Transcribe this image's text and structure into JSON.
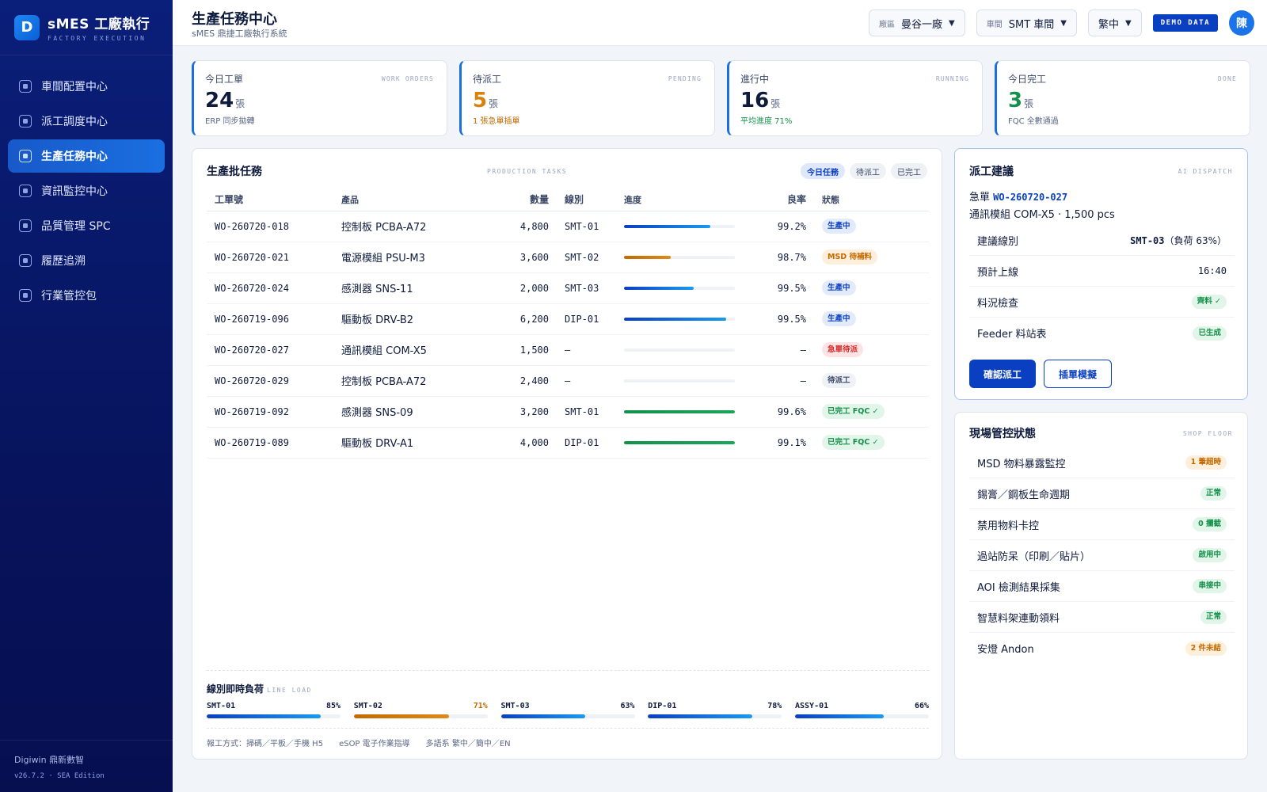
{
  "brand": {
    "logo": "D",
    "name": "sMES 工廠執行",
    "sub": "FACTORY EXECUTION"
  },
  "nav": [
    {
      "label": "車間配置中心"
    },
    {
      "label": "派工調度中心"
    },
    {
      "label": "生產任務中心",
      "active": true
    },
    {
      "label": "資訊監控中心"
    },
    {
      "label": "品質管理 SPC"
    },
    {
      "label": "履歷追溯"
    },
    {
      "label": "行業管控包"
    }
  ],
  "footer": {
    "company": "Digiwin 鼎新數智",
    "version": "v26.7.2 · SEA Edition"
  },
  "header": {
    "title": "生產任務中心",
    "subtitle": "sMES 鼎捷工廠執行系統",
    "plant_key": "廠區",
    "plant_val": "曼谷一廠",
    "shop_key": "車間",
    "shop_val": "SMT 車間",
    "lang": "繁中",
    "demo": "DEMO DATA",
    "avatar": "陳"
  },
  "kpis": [
    {
      "label": "今日工單",
      "en": "WORK ORDERS",
      "value": "24",
      "unit": "張",
      "note": "ERP 同步拋轉",
      "value_color": "#0f1b3d",
      "note_color": "#5a6785"
    },
    {
      "label": "待派工",
      "en": "PENDING",
      "value": "5",
      "unit": "張",
      "note": "1 張急單插單",
      "value_color": "#d9820a",
      "note_color": "#c26a00"
    },
    {
      "label": "進行中",
      "en": "RUNNING",
      "value": "16",
      "unit": "張",
      "note": "平均進度 71%",
      "value_color": "#0f1b3d",
      "note_color": "#14904a"
    },
    {
      "label": "今日完工",
      "en": "DONE",
      "value": "3",
      "unit": "張",
      "note": "FQC 全數通過",
      "value_color": "#14904a",
      "note_color": "#5a6785"
    }
  ],
  "tasks": {
    "title": "生產批任務",
    "en": "PRODUCTION TASKS",
    "tabs": [
      "今日任務",
      "待派工",
      "已完工"
    ],
    "columns": [
      "工單號",
      "產品",
      "數量",
      "線別",
      "進度",
      "良率",
      "狀態"
    ],
    "rows": [
      {
        "wo": "WO-260720-018",
        "product": "控制板 PCBA-A72",
        "qty": "4,800",
        "line": "SMT-01",
        "progress": 0.78,
        "bar": "blue",
        "yield": "99.2%",
        "status": "生產中",
        "kind": "run"
      },
      {
        "wo": "WO-260720-021",
        "product": "電源模組 PSU-M3",
        "qty": "3,600",
        "line": "SMT-02",
        "progress": 0.42,
        "bar": "orange",
        "yield": "98.7%",
        "status": "MSD 待補料",
        "kind": "warn"
      },
      {
        "wo": "WO-260720-024",
        "product": "感測器 SNS-11",
        "qty": "2,000",
        "line": "SMT-03",
        "progress": 0.63,
        "bar": "blue",
        "yield": "99.5%",
        "status": "生產中",
        "kind": "run"
      },
      {
        "wo": "WO-260719-096",
        "product": "驅動板 DRV-B2",
        "qty": "6,200",
        "line": "DIP-01",
        "progress": 0.92,
        "bar": "blue",
        "yield": "99.5%",
        "status": "生產中",
        "kind": "run"
      },
      {
        "wo": "WO-260720-027",
        "product": "通訊模組 COM-X5",
        "qty": "1,500",
        "line": "—",
        "progress": 0,
        "bar": "blue",
        "yield": "—",
        "status": "急單待派",
        "kind": "urgent"
      },
      {
        "wo": "WO-260720-029",
        "product": "控制板 PCBA-A72",
        "qty": "2,400",
        "line": "—",
        "progress": 0,
        "bar": "blue",
        "yield": "—",
        "status": "待派工",
        "kind": "idle"
      },
      {
        "wo": "WO-260719-092",
        "product": "感測器 SNS-09",
        "qty": "3,200",
        "line": "SMT-01",
        "progress": 1.0,
        "bar": "green",
        "yield": "99.6%",
        "status": "已完工 FQC ✓",
        "kind": "done"
      },
      {
        "wo": "WO-260719-089",
        "product": "驅動板 DRV-A1",
        "qty": "4,000",
        "line": "DIP-01",
        "progress": 1.0,
        "bar": "green",
        "yield": "99.1%",
        "status": "已完工 FQC ✓",
        "kind": "done"
      }
    ]
  },
  "load": {
    "title": "線別即時負荷",
    "en": "LINE LOAD",
    "lines": [
      {
        "name": "SMT-01",
        "pct": "85%",
        "value": 0.85,
        "color": "blue"
      },
      {
        "name": "SMT-02",
        "pct": "71%",
        "value": 0.71,
        "color": "orange"
      },
      {
        "name": "SMT-03",
        "pct": "63%",
        "value": 0.63,
        "color": "blue"
      },
      {
        "name": "DIP-01",
        "pct": "78%",
        "value": 0.78,
        "color": "blue"
      },
      {
        "name": "ASSY-01",
        "pct": "66%",
        "value": 0.66,
        "color": "blue"
      }
    ],
    "notes": [
      "報工方式：掃碼／平板／手機 H5",
      "eSOP 電子作業指導",
      "多語系 繁中／簡中／EN"
    ]
  },
  "dispatch": {
    "title": "派工建議",
    "en": "AI DISPATCH",
    "urgent_prefix": "急單",
    "urgent_wo": "WO-260720-027",
    "product_line": "通訊模組 COM-X5 · 1,500 pcs",
    "rows": [
      {
        "key": "建議線別",
        "val_strong": "SMT-03",
        "val_rest": "（負荷 63%）",
        "type": "text"
      },
      {
        "key": "預計上線",
        "val_rest": "16:40",
        "type": "text"
      },
      {
        "key": "料況檢查",
        "val_rest": "齊料 ✓",
        "type": "ok"
      },
      {
        "key": "Feeder 料站表",
        "val_rest": "已生成",
        "type": "ok"
      }
    ],
    "confirm": "確認派工",
    "simulate": "插單模擬"
  },
  "shopfloor": {
    "title": "現場管控狀態",
    "en": "SHOP FLOOR",
    "rows": [
      {
        "label": "MSD 物料暴露監控",
        "status": "1 筆超時",
        "kind": "warn"
      },
      {
        "label": "錫膏／鋼板生命週期",
        "status": "正常",
        "kind": "ok"
      },
      {
        "label": "禁用物料卡控",
        "status": "0 攔截",
        "kind": "ok"
      },
      {
        "label": "過站防呆（印刷／貼片）",
        "status": "啟用中",
        "kind": "ok"
      },
      {
        "label": "AOI 檢測結果採集",
        "status": "串接中",
        "kind": "ok"
      },
      {
        "label": "智慧料架連動領料",
        "status": "正常",
        "kind": "ok"
      },
      {
        "label": "安燈 Andon",
        "status": "2 件未結",
        "kind": "warn"
      }
    ]
  },
  "colors": {
    "blue": "#1a6fe0",
    "orange": "#c26a00",
    "green": "#14904a",
    "accent": "#0b3fc2"
  }
}
